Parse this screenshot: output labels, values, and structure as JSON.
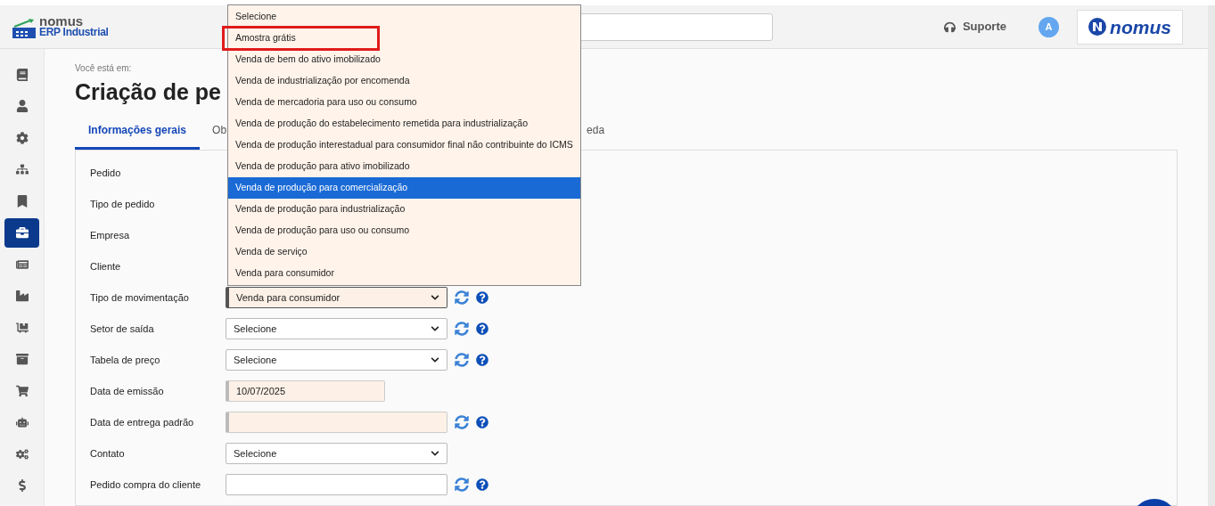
{
  "logo": {
    "name": "nomus",
    "subtitle": "ERP Industrial"
  },
  "header": {
    "support": "Suporte",
    "avatar": "A",
    "brand": "nomus"
  },
  "sidebar": {
    "items": [
      {
        "selected": false
      },
      {
        "selected": false
      },
      {
        "selected": false
      },
      {
        "selected": false
      },
      {
        "selected": false
      },
      {
        "selected": true
      },
      {
        "selected": false
      },
      {
        "selected": false
      },
      {
        "selected": false
      },
      {
        "selected": false
      },
      {
        "selected": false
      },
      {
        "selected": false
      },
      {
        "selected": false
      },
      {
        "selected": false
      }
    ]
  },
  "breadcrumb": "Você está em:",
  "title": "Criação de pe",
  "tabs": [
    {
      "label": "Informações gerais",
      "selected": true
    },
    {
      "label": "Ob",
      "selected": false
    },
    {
      "label": "eda",
      "selected": false
    }
  ],
  "form": {
    "rows": [
      {
        "label": "Pedido",
        "kind": "hidden"
      },
      {
        "label": "Tipo de pedido",
        "kind": "hidden"
      },
      {
        "label": "Empresa",
        "kind": "hidden"
      },
      {
        "label": "Cliente",
        "kind": "hidden"
      },
      {
        "label": "Tipo de movimentação",
        "kind": "select",
        "value": "Venda para consumidor",
        "focused": true,
        "tools": true
      },
      {
        "label": "Setor de saída",
        "kind": "select",
        "value": "Selecione",
        "focused": false,
        "tools": true
      },
      {
        "label": "Tabela de preço",
        "kind": "select",
        "value": "Selecione",
        "focused": false,
        "tools": true
      },
      {
        "label": "Data de emissão",
        "kind": "date",
        "value": "10/07/2025",
        "tools": false
      },
      {
        "label": "Data de entrega padrão",
        "kind": "date-wide",
        "value": "",
        "tools": true
      },
      {
        "label": "Contato",
        "kind": "select",
        "value": "Selecione",
        "focused": false,
        "tools": false
      },
      {
        "label": "Pedido compra do cliente",
        "kind": "text",
        "value": "",
        "tools": true
      }
    ]
  },
  "dropdown": {
    "options": [
      {
        "label": "Selecione",
        "selected": false,
        "highlighted": false
      },
      {
        "label": "Amostra grátis",
        "selected": false,
        "highlighted": true
      },
      {
        "label": "Venda de bem do ativo imobilizado",
        "selected": false,
        "highlighted": false
      },
      {
        "label": "Venda de industrialização por encomenda",
        "selected": false,
        "highlighted": false
      },
      {
        "label": "Venda de mercadoria para uso ou consumo",
        "selected": false,
        "highlighted": false
      },
      {
        "label": "Venda de produção do estabelecimento remetida para industrialização",
        "selected": false,
        "highlighted": false
      },
      {
        "label": "Venda de produção interestadual para consumidor final não contribuinte do ICMS",
        "selected": false,
        "highlighted": false
      },
      {
        "label": "Venda de produção para ativo imobilizado",
        "selected": false,
        "highlighted": false
      },
      {
        "label": "Venda de produção para comercialização",
        "selected": true,
        "highlighted": false
      },
      {
        "label": "Venda de produção para industrialização",
        "selected": false,
        "highlighted": false
      },
      {
        "label": "Venda de produção para uso ou consumo",
        "selected": false,
        "highlighted": false
      },
      {
        "label": "Venda de serviço",
        "selected": false,
        "highlighted": false
      },
      {
        "label": "Venda para consumidor",
        "selected": false,
        "highlighted": false
      }
    ]
  }
}
